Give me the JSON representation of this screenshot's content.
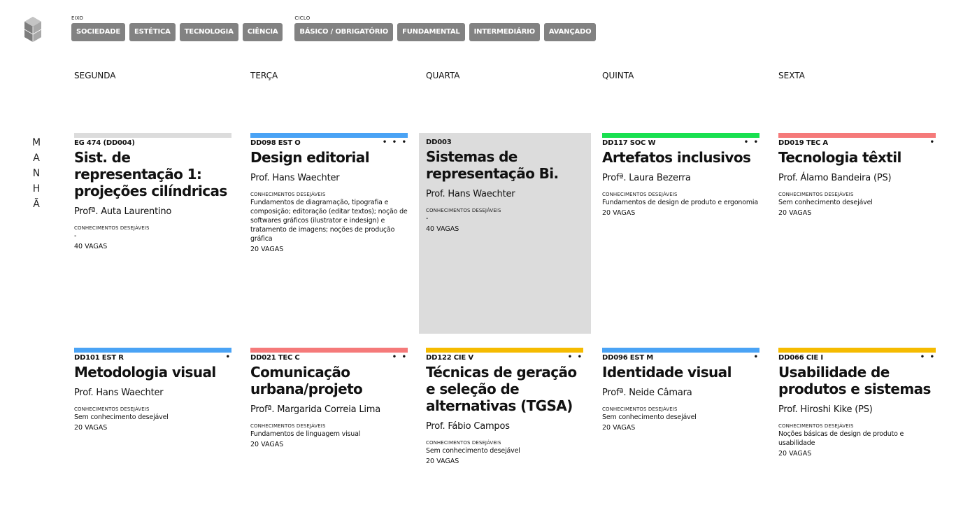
{
  "filters": {
    "eixo": {
      "title": "EIXO",
      "buttons": [
        "SOCIEDADE",
        "ESTÉTICA",
        "TECNOLOGIA",
        "CIÊNCIA"
      ]
    },
    "ciclo": {
      "title": "CICLO",
      "buttons": [
        "BÁSICO / OBRIGATÓRIO",
        "FUNDAMENTAL",
        "INTERMEDIÁRIO",
        "AVANÇADO"
      ]
    }
  },
  "days": [
    "SEGUNDA",
    "TERÇA",
    "QUARTA",
    "QUINTA",
    "SEXTA"
  ],
  "period": [
    "M",
    "A",
    "N",
    "H",
    "Ã"
  ],
  "colors": {
    "chip": "#828282",
    "estetica": "#4aa3f5",
    "sociedade": "#19e050",
    "tecnologia": "#f57a7a",
    "ciencia": "#f5bb00",
    "neutral": "#dcdcdc"
  },
  "knowledge_label": "CONHECIMENTOS DESEJÁVEIS",
  "courses": [
    {
      "code": "EG 474 (DD004)",
      "dots": "",
      "title": "Sist. de representação 1: projeções cilíndricas",
      "prof": "Profª. Auta Laurentino",
      "knowledge": "-",
      "vagas": "40 VAGAS",
      "color": "#dcdcdc",
      "disabled": false
    },
    {
      "code": "DD098 EST O",
      "dots": "• • •",
      "title": "Design editorial",
      "prof": "Prof. Hans Waechter",
      "knowledge": "Fundamentos de diagramação, tipografia e composição; editoração (editar textos); noção de softwares gráficos (ilustrator e indesign) e tratamento de imagens; noções de produção gráfica",
      "vagas": "20 VAGAS",
      "color": "#4aa3f5",
      "disabled": false
    },
    {
      "code": "DD003",
      "dots": "",
      "title": "Sistemas de representação Bi.",
      "prof": "Prof. Hans Waechter",
      "knowledge": "-",
      "vagas": "40 VAGAS",
      "color": "#dcdcdc",
      "disabled": true
    },
    {
      "code": "DD117 SOC W",
      "dots": "• •",
      "title": "Artefatos inclusivos",
      "prof": "Profª. Laura Bezerra",
      "knowledge": "Fundamentos de design de produto e ergonomia",
      "vagas": "20 VAGAS",
      "color": "#19e050",
      "disabled": false
    },
    {
      "code": "DD019 TEC A",
      "dots": "•",
      "title": "Tecnologia têxtil",
      "prof": "Prof. Álamo Bandeira (PS)",
      "knowledge": "Sem conhecimento desejável",
      "vagas": "20 VAGAS",
      "color": "#f57a7a",
      "disabled": false
    },
    {
      "code": "DD101 EST R",
      "dots": "•",
      "title": "Metodologia visual",
      "prof": "Prof. Hans Waechter",
      "knowledge": "Sem conhecimento desejável",
      "vagas": "20 VAGAS",
      "color": "#4aa3f5",
      "disabled": false
    },
    {
      "code": "DD021 TEC C",
      "dots": "• •",
      "title": "Comunicação urbana/projeto",
      "prof": "Profª. Margarida Correia Lima",
      "knowledge": "Fundamentos de linguagem visual",
      "vagas": "20 VAGAS",
      "color": "#f57a7a",
      "disabled": false
    },
    {
      "code": "DD122 CIE V",
      "dots": "• •",
      "title": "Técnicas de geração e seleção de alternativas (TGSA)",
      "prof": "Prof. Fábio Campos",
      "knowledge": "Sem conhecimento desejável",
      "vagas": "20 VAGAS",
      "color": "#f5bb00",
      "disabled": false
    },
    {
      "code": "DD096 EST M",
      "dots": "•",
      "title": "Identidade visual",
      "prof": "Profª. Neide Câmara",
      "knowledge": "Sem conhecimento desejável",
      "vagas": "20 VAGAS",
      "color": "#4aa3f5",
      "disabled": false
    },
    {
      "code": "DD066 CIE I",
      "dots": "• •",
      "title": "Usabilidade de produtos e sistemas",
      "prof": "Prof. Hiroshi Kike (PS)",
      "knowledge": "Noções básicas de design de produto e usabilidade",
      "vagas": "20 VAGAS",
      "color": "#f5bb00",
      "disabled": false
    }
  ]
}
